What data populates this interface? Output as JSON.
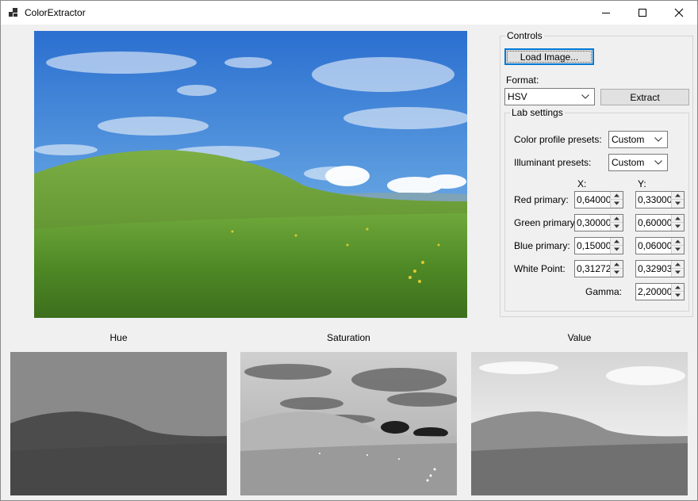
{
  "window": {
    "title": "ColorExtractor"
  },
  "icons": {
    "app": "app-grid-icon",
    "minimize": "minimize-icon",
    "maximize": "maximize-icon",
    "close": "close-icon",
    "dropdown": "chevron-down-icon",
    "spin_up": "spin-up-arrow-icon",
    "spin_down": "spin-down-arrow-icon"
  },
  "controls": {
    "group_title": "Controls",
    "load_button": "Load Image...",
    "format_label": "Format:",
    "format_value": "HSV",
    "extract_button": "Extract"
  },
  "lab": {
    "group_title": "Lab settings",
    "color_profile_label": "Color profile presets:",
    "color_profile_value": "Custom",
    "illuminant_label": "Illuminant presets:",
    "illuminant_value": "Custom",
    "x_header": "X:",
    "y_header": "Y:",
    "rows": [
      {
        "label": "Red primary:",
        "x": "0,64000",
        "y": "0,33000"
      },
      {
        "label": "Green primary:",
        "x": "0,30000",
        "y": "0,60000"
      },
      {
        "label": "Blue primary:",
        "x": "0,15000",
        "y": "0,06000"
      },
      {
        "label": "White Point:",
        "x": "0,31272",
        "y": "0,32903"
      }
    ],
    "gamma_label": "Gamma:",
    "gamma_value": "2,20000"
  },
  "outputs": {
    "hue": "Hue",
    "saturation": "Saturation",
    "value": "Value"
  },
  "colors": {
    "accent": "#0078d7",
    "window_bg": "#f0f0f0",
    "sky": "#5c9fdc",
    "grass": "#5a8a2e"
  }
}
